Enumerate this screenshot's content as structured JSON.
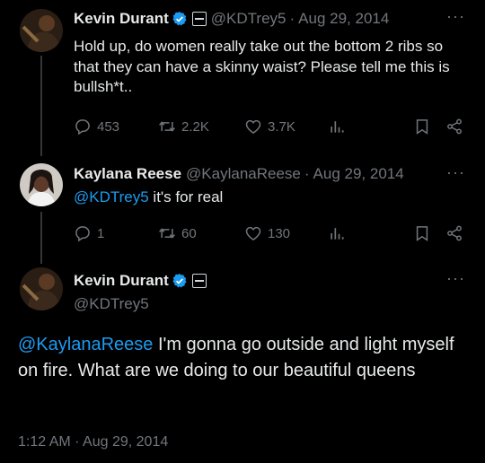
{
  "tweets": [
    {
      "name": "Kevin Durant",
      "handle": "@KDTrey5",
      "date": "Aug 29, 2014",
      "text": "Hold up, do women really take out the bottom 2 ribs so that they can have a skinny waist? Please tell me this is bullsh*t..",
      "replies": "453",
      "retweets": "2.2K",
      "likes": "3.7K"
    },
    {
      "name": "Kaylana Reese",
      "handle": "@KaylanaReese",
      "date": "Aug 29, 2014",
      "mention": "@KDTrey5",
      "text": " it's for real",
      "replies": "1",
      "retweets": "60",
      "likes": "130"
    }
  ],
  "main_tweet": {
    "name": "Kevin Durant",
    "handle": "@KDTrey5",
    "mention": "@KaylanaReese",
    "text": " I'm gonna go outside and light myself on fire. What are we doing to our beautiful queens",
    "timestamp": "1:12 AM · Aug 29, 2014"
  },
  "separator": "·",
  "more_label": "···",
  "colors": {
    "background": "#000000",
    "accent": "#1d9bf0",
    "muted": "#71767b",
    "verified": "#1d9bf0"
  },
  "icons": [
    "reply-icon",
    "retweet-icon",
    "like-icon",
    "views-icon",
    "bookmark-icon",
    "share-icon",
    "verified-badge-icon",
    "affiliation-badge-icon",
    "more-icon"
  ]
}
